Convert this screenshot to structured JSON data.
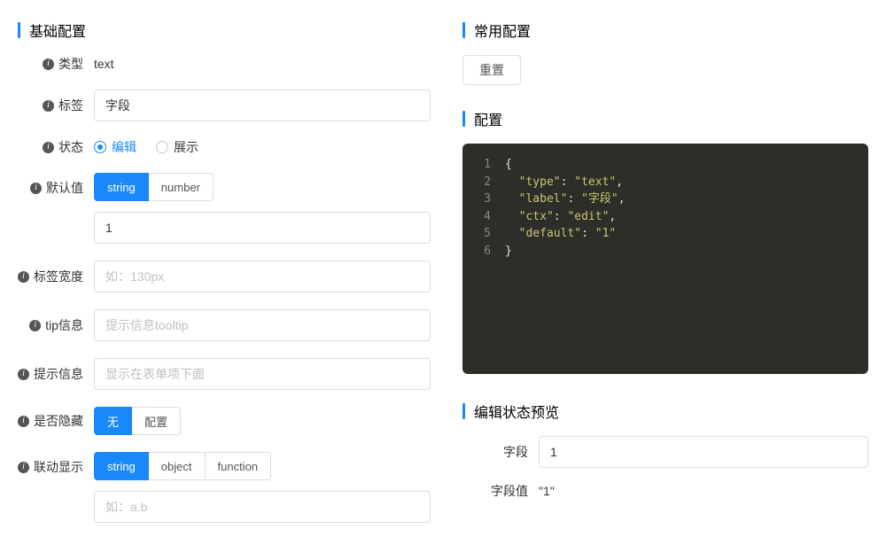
{
  "left": {
    "title": "基础配置",
    "rows": {
      "type_label": "类型",
      "type_value": "text",
      "label_label": "标签",
      "label_value": "字段",
      "state_label": "状态",
      "state_opts": {
        "edit": "编辑",
        "show": "展示"
      },
      "default_label": "默认值",
      "default_seg": {
        "string": "string",
        "number": "number"
      },
      "default_value": "1",
      "labelwidth_label": "标签宽度",
      "labelwidth_placeholder": "如：130px",
      "tip_label": "tip信息",
      "tip_placeholder": "提示信息tooltip",
      "hint_label": "提示信息",
      "hint_placeholder": "显示在表单项下面",
      "hidden_label": "是否隐藏",
      "hidden_seg": {
        "none": "无",
        "config": "配置"
      },
      "link_label": "联动显示",
      "link_seg": {
        "string": "string",
        "object": "object",
        "function": "function"
      },
      "link_placeholder": "如：a.b"
    }
  },
  "right": {
    "common_title": "常用配置",
    "reset_label": "重置",
    "config_title": "配置",
    "config_json": {
      "lines": [
        {
          "n": "1",
          "txt": "{"
        },
        {
          "n": "2",
          "k": "\"type\"",
          "v": "\"text\"",
          "comma": true
        },
        {
          "n": "3",
          "k": "\"label\"",
          "v": "\"字段\"",
          "comma": true
        },
        {
          "n": "4",
          "k": "\"ctx\"",
          "v": "\"edit\"",
          "comma": true
        },
        {
          "n": "5",
          "k": "\"default\"",
          "v": "\"1\""
        },
        {
          "n": "6",
          "txt": "}"
        }
      ]
    },
    "preview_title": "编辑状态预览",
    "preview": {
      "field_label": "字段",
      "field_value": "1",
      "value_label": "字段值",
      "value_text": "\"1\""
    }
  }
}
